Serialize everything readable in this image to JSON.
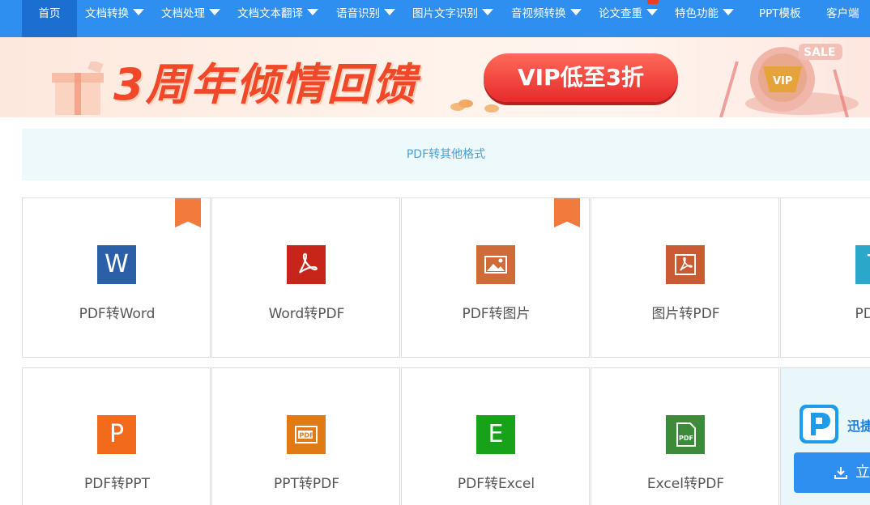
{
  "nav": {
    "items": [
      {
        "label": "首页"
      },
      {
        "label": "文档转换"
      },
      {
        "label": "文档处理"
      },
      {
        "label": "文档文本翻译"
      },
      {
        "label": "语音识别"
      },
      {
        "label": "图片文字识别"
      },
      {
        "label": "音视频转换"
      },
      {
        "label": "论文查重"
      },
      {
        "label": "特色功能"
      },
      {
        "label": "PPT模板"
      },
      {
        "label": "客户端"
      }
    ]
  },
  "banner": {
    "title": "3周年倾情回馈",
    "vip_button": "VIP低至3折",
    "sale_tag": "SALE",
    "vip_tag": "VIP"
  },
  "section": {
    "title": "PDF转其他格式"
  },
  "tools_row1": [
    {
      "label": "PDF转Word",
      "icon": "W",
      "color": "#2b5fa8",
      "hot": true
    },
    {
      "label": "Word转PDF",
      "icon": "pdf-acrobat-icon",
      "color": "#c8251a",
      "hot": false
    },
    {
      "label": "PDF转图片",
      "icon": "image-icon",
      "color": "#cf6b37",
      "hot": true
    },
    {
      "label": "图片转PDF",
      "icon": "pdf-acrobat-icon",
      "color": "#c95a33",
      "hot": false
    },
    {
      "label": "PDF转",
      "icon": "T",
      "color": "#2aa7c9",
      "hot": false
    }
  ],
  "tools_row2": [
    {
      "label": "PDF转PPT",
      "icon": "P",
      "color": "#f26b1d"
    },
    {
      "label": "PPT转PDF",
      "icon": "PDF",
      "color": "#e07a14"
    },
    {
      "label": "PDF转Excel",
      "icon": "E",
      "color": "#18a21a"
    },
    {
      "label": "Excel转PDF",
      "icon": "PDF",
      "color": "#3d8a3a"
    }
  ],
  "promo": {
    "name": "迅捷",
    "button_label": "立"
  }
}
